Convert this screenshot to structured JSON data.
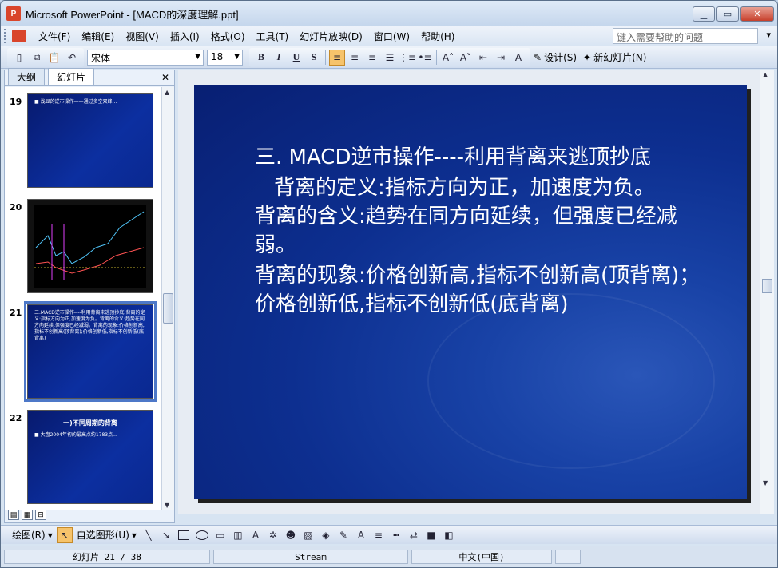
{
  "window": {
    "title": "Microsoft PowerPoint - [MACD的深度理解.ppt]",
    "app_icon_text": "P"
  },
  "menu": {
    "items": [
      "文件(F)",
      "编辑(E)",
      "视图(V)",
      "插入(I)",
      "格式(O)",
      "工具(T)",
      "幻灯片放映(D)",
      "窗口(W)",
      "帮助(H)"
    ],
    "help_placeholder": "键入需要帮助的问题"
  },
  "toolbar": {
    "font_name": "宋体",
    "font_size": "18",
    "design_label": "设计(S)",
    "new_slide_label": "新幻灯片(N)"
  },
  "left_panel": {
    "tabs": [
      "大纲",
      "幻灯片"
    ],
    "active_tab": "幻灯片",
    "thumbnails": [
      {
        "number": "19",
        "text": "■ 浅显的逆市操作——通过多空双峰..."
      },
      {
        "number": "20",
        "text": ""
      },
      {
        "number": "21",
        "text": "三.MACD逆市操作----利用背离来逃顶抄底 背离的定义:指标方向为正,加速度为负。背离的含义:趋势在同方向延续,但强度已经减弱。背离的现象:价格创新高,指标不创新高(顶背离);价格创新低,指标不创新低(底背离)"
      },
      {
        "number": "22",
        "title": "一)不同周期的背离",
        "text": "■ 大盘2004年初的最高点约1783点..."
      }
    ]
  },
  "slide": {
    "line1": "三. MACD逆市操作----利用背离来逃顶抄底",
    "line2": "背离的定义:指标方向为正，加速度为负。",
    "para1": "背离的含义:趋势在同方向延续，但强度已经减弱。",
    "para2": "背离的现象:价格创新高,指标不创新高(顶背离)；价格创新低,指标不创新低(底背离)"
  },
  "drawing_toolbar": {
    "draw_label": "绘图(R)",
    "autoshapes_label": "自选图形(U)"
  },
  "status": {
    "slide_info": "幻灯片 21 / 38",
    "design": "Stream",
    "language": "中文(中国)"
  }
}
